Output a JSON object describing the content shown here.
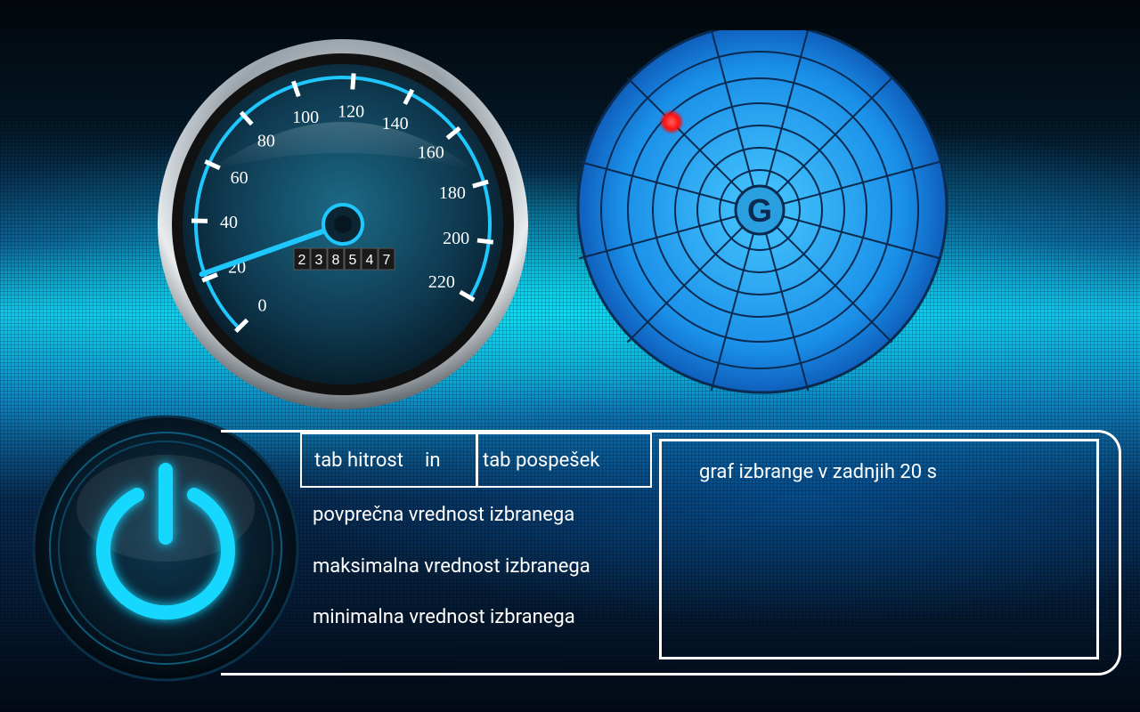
{
  "speedometer": {
    "scale_labels": [
      "0",
      "20",
      "40",
      "60",
      "80",
      "100",
      "120",
      "140",
      "160",
      "180",
      "200",
      "220"
    ],
    "odometer_digits": [
      "2",
      "3",
      "8",
      "5",
      "4",
      "7"
    ],
    "current_speed": 22
  },
  "radar": {
    "center_label": "G",
    "marker_color": "#ff2020"
  },
  "power": {
    "icon": "power-icon",
    "glow_color": "#14d8ff"
  },
  "tabs": {
    "speed_label": "tab hitrost",
    "conjunction": "in",
    "accel_label": "tab pospešek"
  },
  "stats": {
    "average": "povprečna vrednost izbranega",
    "maximum": "maksimalna vrednost izbranega",
    "minimum": "minimalna vrednost izbranega"
  },
  "graph": {
    "label": "graf izbrange v zadnjih 20 s"
  },
  "colors": {
    "accent": "#1ec8ff",
    "text": "#ffffff"
  }
}
